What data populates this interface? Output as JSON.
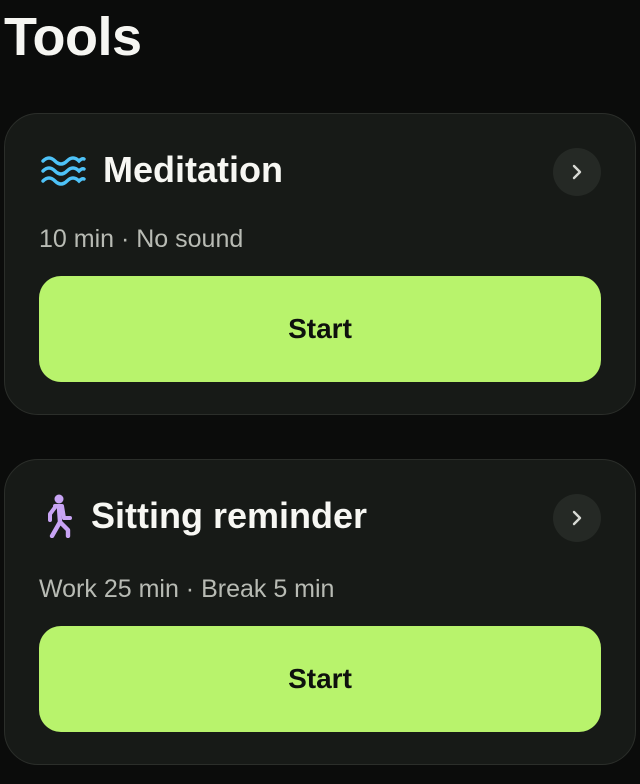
{
  "page": {
    "title": "Tools"
  },
  "cards": [
    {
      "icon": "waves-icon",
      "icon_color": "#4ec2f7",
      "title": "Meditation",
      "subtitle": "10 min · No sound",
      "button_label": "Start"
    },
    {
      "icon": "walking-person-icon",
      "icon_color": "#c8a4f4",
      "title": "Sitting reminder",
      "subtitle": "Work 25 min · Break 5 min",
      "button_label": "Start"
    }
  ],
  "colors": {
    "background": "#0b0c0b",
    "card": "#171a17",
    "accent": "#b8f36c"
  }
}
